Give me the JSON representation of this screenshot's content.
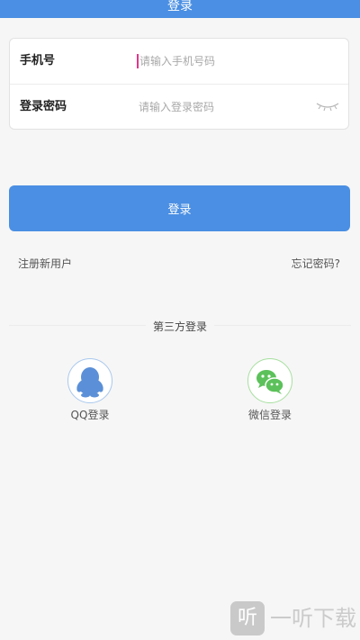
{
  "header": {
    "title": "登录"
  },
  "form": {
    "phone": {
      "label": "手机号",
      "placeholder": "请输入手机号码"
    },
    "password": {
      "label": "登录密码",
      "placeholder": "请输入登录密码"
    }
  },
  "actions": {
    "login_label": "登录",
    "register_label": "注册新用户",
    "forgot_label": "忘记密码?"
  },
  "third_party": {
    "title": "第三方登录",
    "options": [
      {
        "label": "QQ登录",
        "icon": "qq-penguin-icon",
        "color": "#5b90d8"
      },
      {
        "label": "微信登录",
        "icon": "wechat-icon",
        "color": "#5cc15a"
      }
    ]
  },
  "watermark": {
    "logo": "听",
    "text": "一听下载"
  },
  "colors": {
    "primary": "#4a8fe3",
    "cursor": "#e2368a",
    "background": "#f6f6f6"
  }
}
